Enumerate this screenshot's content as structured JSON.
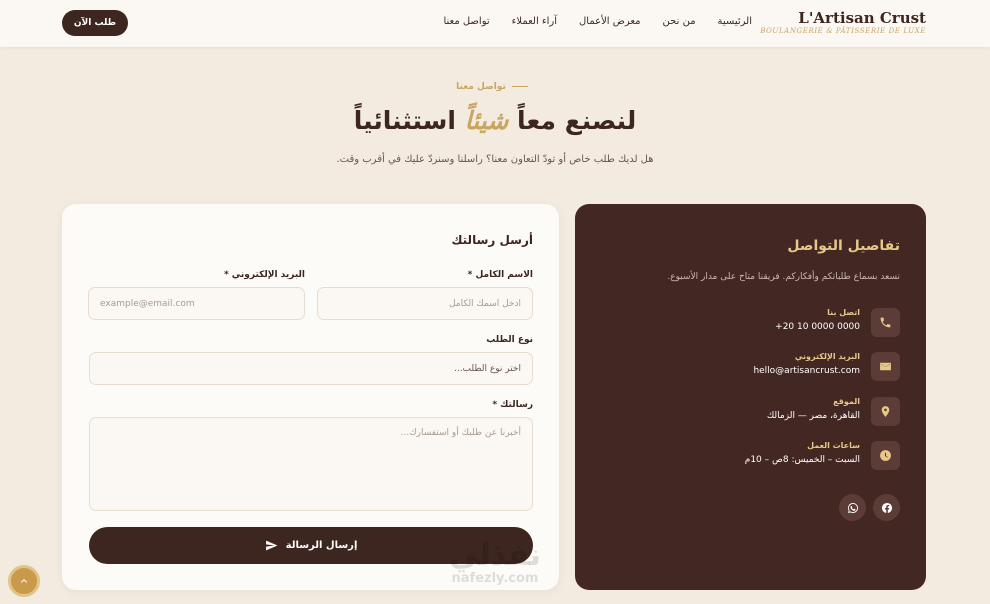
{
  "header": {
    "brand_name": "L'Artisan Crust",
    "brand_tagline": "BOULANGERIE & PÂTISSERIE DE LUXE",
    "nav": [
      "الرئيسية",
      "من نحن",
      "معرض الأعمال",
      "آراء العملاء",
      "تواصل معنا"
    ],
    "order_button": "طلب الآن"
  },
  "hero": {
    "eyebrow": "تواصل معنا",
    "title_part1": "لنصنع معاً",
    "title_accent": "شيئاً",
    "title_part2": "استثنائياً",
    "subtitle": "هل لديك طلب خاص أو تودّ التعاون معنا؟ راسلنا وسنردّ عليك في أقرب وقت."
  },
  "form": {
    "title": "أرسل رسالتك",
    "name_label": "الاسم الكامل *",
    "name_placeholder": "أدخل اسمك الكامل",
    "email_label": "البريد الإلكتروني *",
    "email_placeholder": "example@email.com",
    "type_label": "نوع الطلب",
    "type_placeholder": "اختر نوع الطلب...",
    "message_label": "رسالتك *",
    "message_placeholder": "أخبرنا عن طلبك أو استفسارك...",
    "submit": "إرسال الرسالة"
  },
  "info": {
    "title": "تفاصيل التواصل",
    "description": "نسعد بسماع طلباتكم وأفكاركم. فريقنا متاح على مدار الأسبوع.",
    "items": [
      {
        "label": "اتصل بنا",
        "value": "+20 10 0000 0000",
        "icon": "phone-icon"
      },
      {
        "label": "البريد الإلكتروني",
        "value": "hello@artisancrust.com",
        "icon": "envelope-icon"
      },
      {
        "label": "الموقع",
        "value": "القاهرة، مصر — الزمالك",
        "icon": "location-pin-icon"
      },
      {
        "label": "ساعات العمل",
        "value": "السبت – الخميس: 8ص – 10م",
        "icon": "clock-icon"
      }
    ],
    "social": [
      "facebook-icon",
      "whatsapp-icon"
    ]
  },
  "watermark": {
    "arabic": "نفذلي",
    "latin": "nafezly.com"
  },
  "colors": {
    "background": "#f3ebe0",
    "primary_dark": "#3d2520",
    "accent_gold": "#c8a560",
    "info_card": "#432723"
  }
}
